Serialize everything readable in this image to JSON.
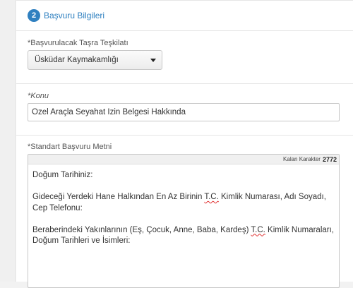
{
  "step": {
    "number": "2",
    "title": "Başvuru Bilgileri"
  },
  "fields": {
    "organization": {
      "label": "*Başvurulacak Taşra Teşkilatı",
      "selected": "Üsküdar Kaymakamlığı"
    },
    "subject": {
      "label": "*Konu",
      "value": "Özel Araçla Seyahat İzin Belgesi Hakkında"
    },
    "standard_text": {
      "label": "*Standart Başvuru Metni",
      "remaining_label": "Kalan Karakter",
      "remaining_count": "2772",
      "lines": {
        "p1": "Doğum Tarihiniz:",
        "p2_before": "Gideceği Yerdeki Hane Halkından En Az Birinin ",
        "p2_tc": "T.C.",
        "p2_after": " Kimlik Numarası, Adı Soyadı, Cep Telefonu:",
        "p3_before": "Beraberindeki Yakınlarının (Eş, Çocuk, Anne, Baba, Kardeş) ",
        "p3_tc": "T.C.",
        "p3_after": " Kimlik Numaraları, Doğum Tarihleri ve İsimleri:"
      }
    }
  }
}
